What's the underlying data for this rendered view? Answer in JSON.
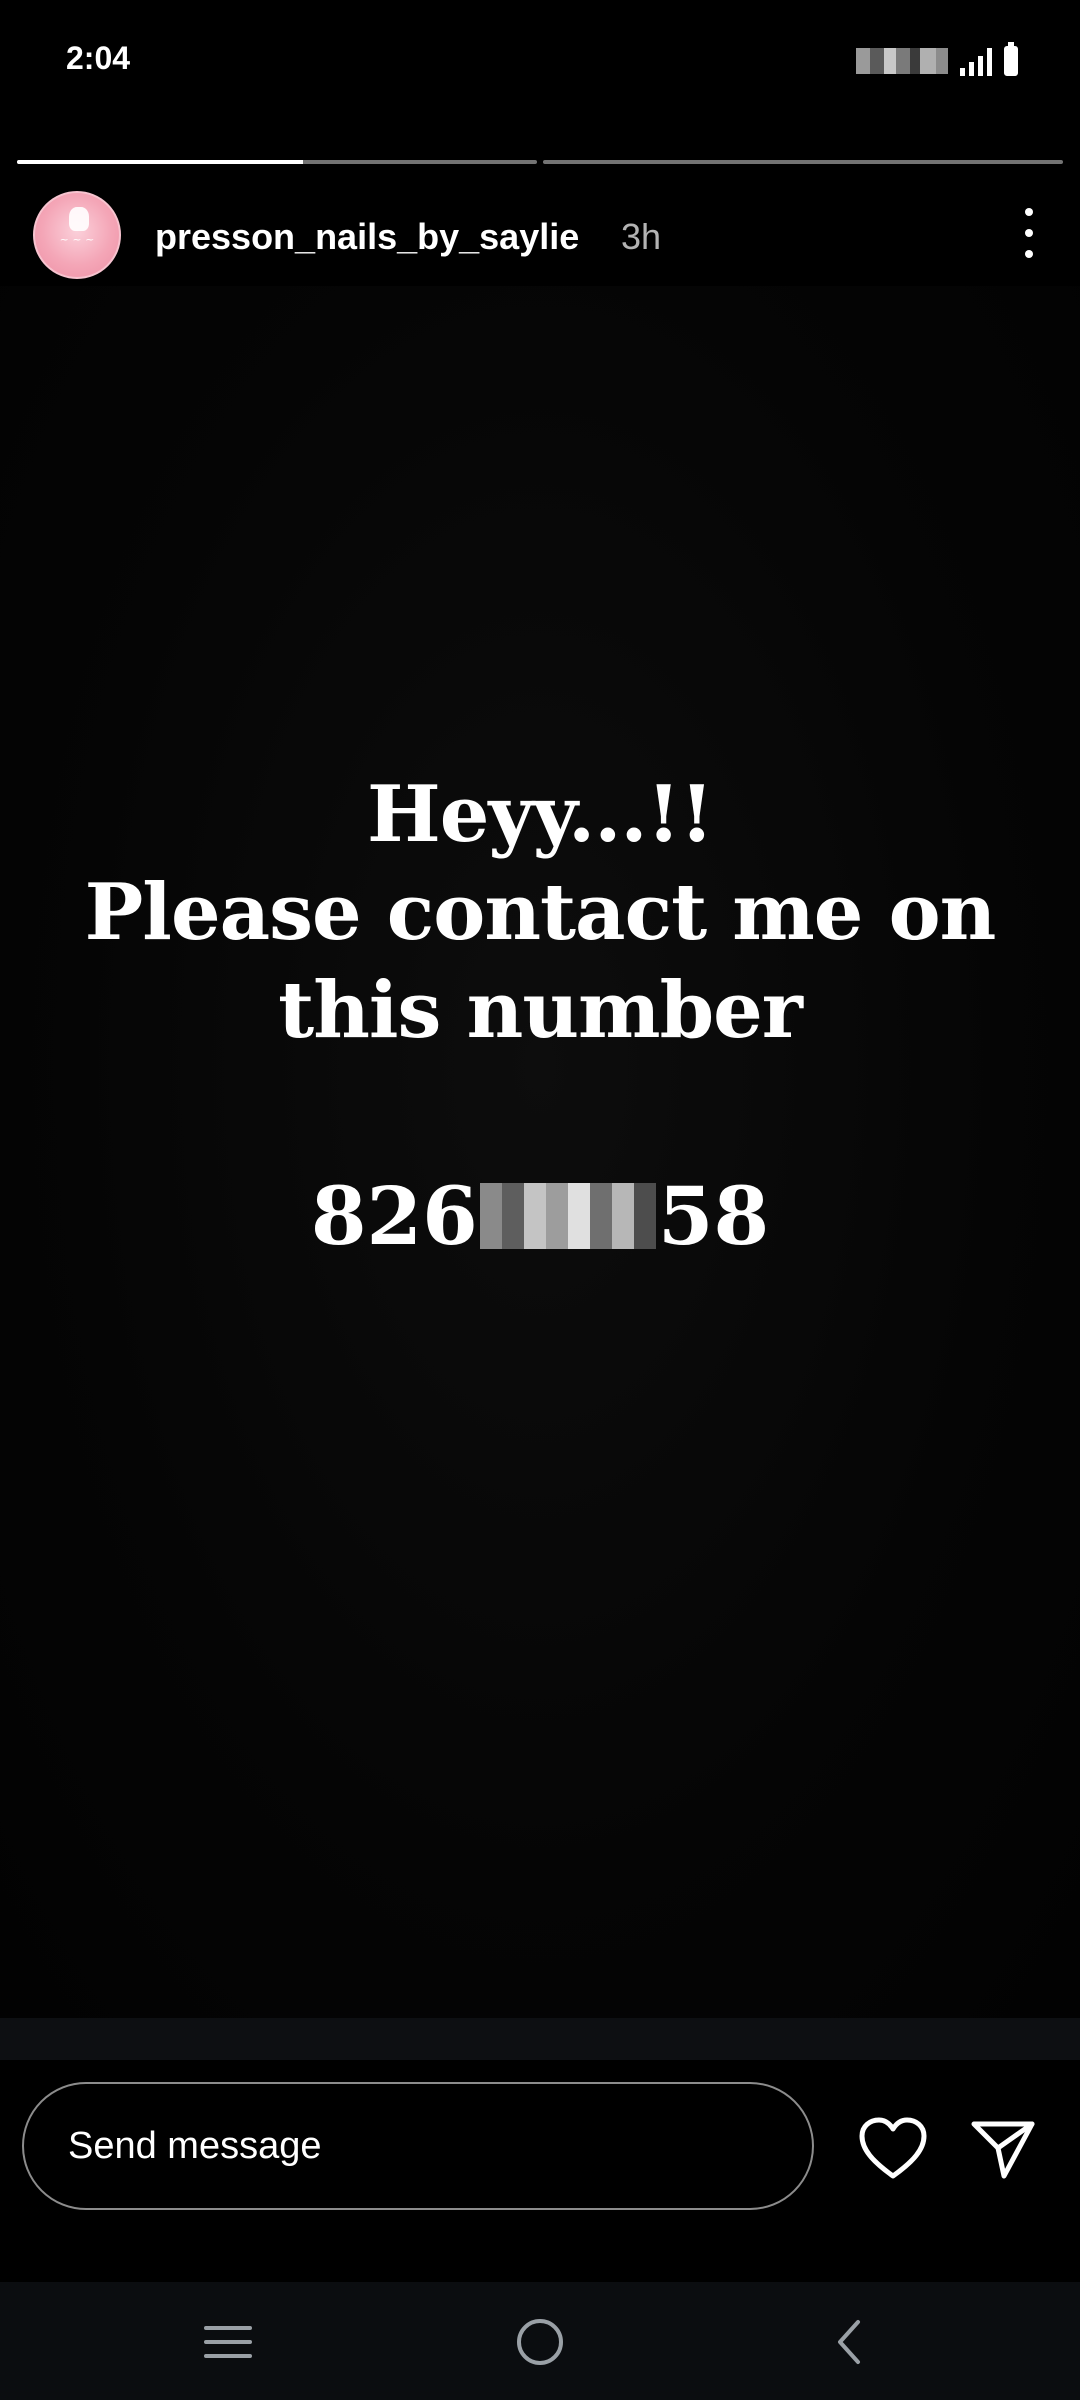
{
  "status_bar": {
    "time": "2:04"
  },
  "story": {
    "progress": [
      0.55,
      0
    ],
    "username": "presson_nails_by_saylie",
    "time_ago": "3h",
    "text_lines": [
      "Heyy...!!",
      "Please contact me on",
      "this number"
    ],
    "phone_prefix": "826",
    "phone_suffix": "58"
  },
  "reply_bar": {
    "message_placeholder": "Send message"
  },
  "icons": {
    "more": "more-vertical-icon",
    "heart": "heart-icon",
    "share": "send-icon",
    "nav_menu": "recent-apps-icon",
    "nav_home": "home-icon",
    "nav_back": "back-icon"
  },
  "colors": {
    "background": "#000000",
    "avatar_pink": "#f4a6b7",
    "nav_bar": "#0b0d10"
  }
}
